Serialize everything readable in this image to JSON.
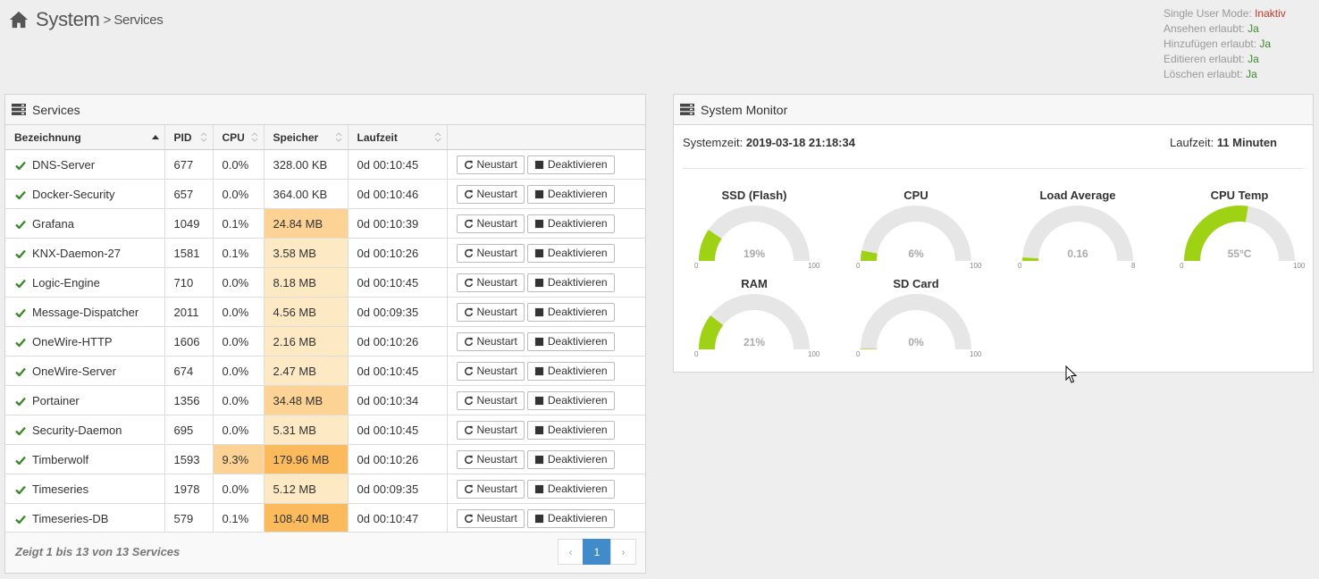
{
  "header": {
    "title": "System",
    "separator": ">",
    "subtitle": "Services"
  },
  "permissions": [
    {
      "label": "Single User Mode:",
      "value": "Inaktiv",
      "state": "no"
    },
    {
      "label": "Ansehen erlaubt:",
      "value": "Ja",
      "state": "yes"
    },
    {
      "label": "Hinzufügen erlaubt:",
      "value": "Ja",
      "state": "yes"
    },
    {
      "label": "Editieren erlaubt:",
      "value": "Ja",
      "state": "yes"
    },
    {
      "label": "Löschen erlaubt:",
      "value": "Ja",
      "state": "yes"
    }
  ],
  "services": {
    "title": "Services",
    "columns": [
      "Bezeichnung",
      "PID",
      "CPU",
      "Speicher",
      "Laufzeit"
    ],
    "restart_label": "Neustart",
    "deactivate_label": "Deaktivieren",
    "rows": [
      {
        "name": "DNS-Server",
        "pid": "677",
        "cpu": "0.0%",
        "mem": "328.00 KB",
        "mem_level": "none",
        "cpu_level": "none",
        "uptime": "0d 00:10:45"
      },
      {
        "name": "Docker-Security",
        "pid": "657",
        "cpu": "0.0%",
        "mem": "364.00 KB",
        "mem_level": "none",
        "cpu_level": "none",
        "uptime": "0d 00:10:46"
      },
      {
        "name": "Grafana",
        "pid": "1049",
        "cpu": "0.1%",
        "mem": "24.84 MB",
        "mem_level": "m",
        "cpu_level": "none",
        "uptime": "0d 00:10:39"
      },
      {
        "name": "KNX-Daemon-27",
        "pid": "1581",
        "cpu": "0.1%",
        "mem": "3.58 MB",
        "mem_level": "l",
        "cpu_level": "none",
        "uptime": "0d 00:10:26"
      },
      {
        "name": "Logic-Engine",
        "pid": "710",
        "cpu": "0.0%",
        "mem": "8.18 MB",
        "mem_level": "l",
        "cpu_level": "none",
        "uptime": "0d 00:10:45"
      },
      {
        "name": "Message-Dispatcher",
        "pid": "2011",
        "cpu": "0.0%",
        "mem": "4.56 MB",
        "mem_level": "l",
        "cpu_level": "none",
        "uptime": "0d 00:09:35"
      },
      {
        "name": "OneWire-HTTP",
        "pid": "1606",
        "cpu": "0.0%",
        "mem": "2.16 MB",
        "mem_level": "l",
        "cpu_level": "none",
        "uptime": "0d 00:10:26"
      },
      {
        "name": "OneWire-Server",
        "pid": "674",
        "cpu": "0.0%",
        "mem": "2.47 MB",
        "mem_level": "l",
        "cpu_level": "none",
        "uptime": "0d 00:10:45"
      },
      {
        "name": "Portainer",
        "pid": "1356",
        "cpu": "0.0%",
        "mem": "34.48 MB",
        "mem_level": "m",
        "cpu_level": "none",
        "uptime": "0d 00:10:34"
      },
      {
        "name": "Security-Daemon",
        "pid": "695",
        "cpu": "0.0%",
        "mem": "5.31 MB",
        "mem_level": "l",
        "cpu_level": "none",
        "uptime": "0d 00:10:45"
      },
      {
        "name": "Timberwolf",
        "pid": "1593",
        "cpu": "9.3%",
        "mem": "179.96 MB",
        "mem_level": "h",
        "cpu_level": "m",
        "uptime": "0d 00:10:26"
      },
      {
        "name": "Timeseries",
        "pid": "1978",
        "cpu": "0.0%",
        "mem": "5.12 MB",
        "mem_level": "l",
        "cpu_level": "none",
        "uptime": "0d 00:09:35"
      },
      {
        "name": "Timeseries-DB",
        "pid": "579",
        "cpu": "0.1%",
        "mem": "108.40 MB",
        "mem_level": "h",
        "cpu_level": "none",
        "uptime": "0d 00:10:47"
      }
    ],
    "footer_info": "Zeigt 1 bis 13 von 13 Services",
    "pager": {
      "prev": "‹",
      "current": "1",
      "next": "›"
    }
  },
  "monitor": {
    "title": "System Monitor",
    "systemzeit_label": "Systemzeit:",
    "systemzeit_value": "2019-03-18 21:18:34",
    "laufzeit_label": "Laufzeit:",
    "laufzeit_value": "11 Minuten",
    "gauge_color": "#9fd214",
    "track_color": "#e6e6e6",
    "gauges": [
      {
        "title": "SSD (Flash)",
        "value": 19,
        "max": 100,
        "min_label": "0",
        "max_label": "100",
        "display": "19%"
      },
      {
        "title": "CPU",
        "value": 6,
        "max": 100,
        "min_label": "0",
        "max_label": "100",
        "display": "6%"
      },
      {
        "title": "Load Average",
        "value": 0.16,
        "max": 8,
        "min_label": "0",
        "max_label": "8",
        "display": "0.16"
      },
      {
        "title": "CPU Temp",
        "value": 55,
        "max": 100,
        "min_label": "0",
        "max_label": "100",
        "display": "55°C"
      },
      {
        "title": "RAM",
        "value": 21,
        "max": 100,
        "min_label": "0",
        "max_label": "100",
        "display": "21%"
      },
      {
        "title": "SD Card",
        "value": 0,
        "max": 100,
        "min_label": "0",
        "max_label": "100",
        "display": "0%"
      }
    ]
  }
}
